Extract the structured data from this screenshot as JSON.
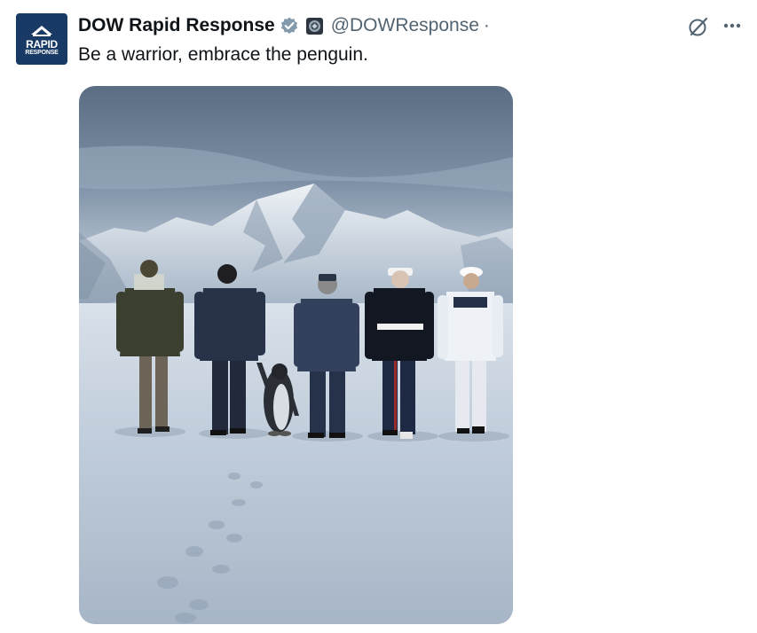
{
  "tweet": {
    "avatar": {
      "line1": "RAPID",
      "line2": "RESPONSE"
    },
    "display_name": "DOW Rapid Response",
    "handle": "@DOWResponse",
    "separator": "·",
    "text": "Be a warrior, embrace the penguin.",
    "media": {
      "description_icon": "photo",
      "subject": "five service members walking across snow toward mountains beside a penguin"
    }
  },
  "icons": {
    "verified": "verified-badge-icon",
    "affiliation": "affiliation-badge-icon",
    "grok": "grok-icon",
    "more": "more-options-icon"
  },
  "colors": {
    "text_primary": "#0f1419",
    "text_secondary": "#536471",
    "verified_gray": "#829aab",
    "avatar_bg": "#1a3a66"
  }
}
